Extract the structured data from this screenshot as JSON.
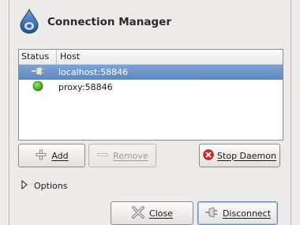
{
  "window": {
    "title": "Connection Manager"
  },
  "table": {
    "headers": {
      "status": "Status",
      "host": "Host"
    },
    "rows": [
      {
        "host": "localhost:58846",
        "status_icon": "disconnected-plug-icon",
        "selected": true
      },
      {
        "host": "proxy:58846",
        "status_icon": "online-green-dot-icon",
        "selected": false
      }
    ]
  },
  "buttons": {
    "add": "Add",
    "remove": "Remove",
    "stop_daemon": "Stop Daemon",
    "close": "Close",
    "disconnect": "Disconnect"
  },
  "options": {
    "label": "Options"
  },
  "colors": {
    "selection": "#6b8fc6",
    "online": "#3fa51f",
    "stop_icon": "#d62a25",
    "app_icon": "#2f5f9e"
  }
}
